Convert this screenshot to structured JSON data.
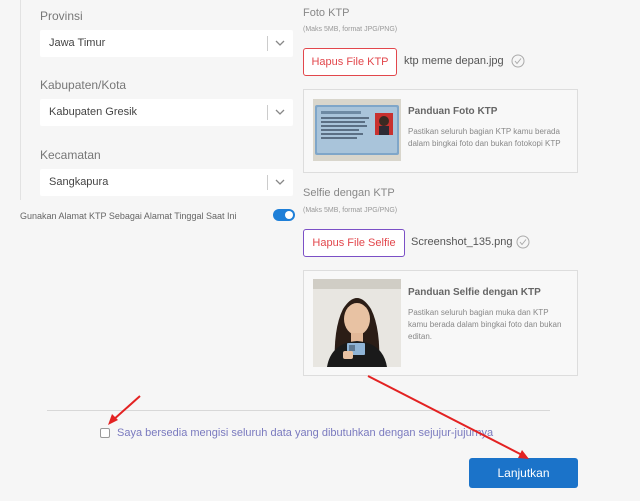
{
  "form": {
    "province": {
      "label": "Provinsi",
      "value": "Jawa Timur"
    },
    "regency": {
      "label": "Kabupaten/Kota",
      "value": "Kabupaten Gresik"
    },
    "district": {
      "label": "Kecamatan",
      "value": "Sangkapura"
    },
    "use_ktp_address_label": "Gunakan Alamat KTP Sebagai Alamat Tinggal Saat Ini",
    "use_ktp_address_on": true
  },
  "ktp": {
    "title": "Foto KTP",
    "hint": "(Maks 5MB, format JPG/PNG)",
    "delete_label": "Hapus File KTP",
    "filename": "ktp meme depan.jpg",
    "guide_title": "Panduan Foto KTP",
    "guide_text": "Pastikan seluruh bagian KTP kamu berada dalam bingkai foto dan bukan fotokopi KTP"
  },
  "selfie": {
    "title": "Selfie dengan KTP",
    "hint": "(Maks 5MB, format JPG/PNG)",
    "delete_label": "Hapus File Selfie",
    "filename": "Screenshot_135.png",
    "guide_title": "Panduan Selfie dengan KTP",
    "guide_text": "Pastikan seluruh bagian muka dan KTP kamu berada dalam bingkai foto dan bukan editan."
  },
  "agreement": {
    "label": "Saya bersedia mengisi seluruh data yang dibutuhkan dengan sejujur-jujurnya",
    "checked": false
  },
  "actions": {
    "next_label": "Lanjutkan"
  },
  "colors": {
    "primary": "#1b73c9",
    "danger": "#e2474c",
    "annotation_arrow": "#e32222"
  }
}
